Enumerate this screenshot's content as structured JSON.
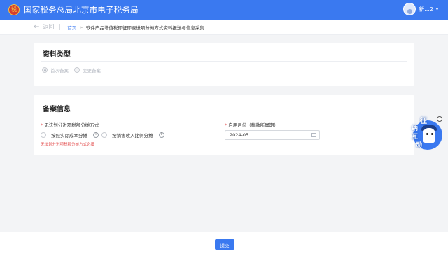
{
  "header": {
    "emblem": "税",
    "title": "国家税务总局北京市电子税务局",
    "user_name": "新...2",
    "caret": "▾"
  },
  "crumbbar": {
    "back_label": "返回",
    "back_arrow": "←",
    "home": "首页",
    "separator": ">",
    "current": "软件产品增值税即征即退进项分摊方式资料报送与信息采集"
  },
  "section_material": {
    "title": "资料类型",
    "options": [
      {
        "label": "首次备案",
        "checked": true
      },
      {
        "label": "变更备案",
        "checked": false
      }
    ]
  },
  "section_filing": {
    "title": "备案信息",
    "allocation_field": {
      "required_mark": "*",
      "label": "无法划分进项税额分摊方式",
      "options": [
        {
          "label": "按照实际成本分摊",
          "info": "i"
        },
        {
          "label": "按销售收入比例分摊",
          "info": "i"
        }
      ],
      "error": "无法划分进项税额分摊方式必填"
    },
    "start_month_field": {
      "required_mark": "*",
      "label": "启用月份（税款所属期）",
      "value": "2024-05"
    }
  },
  "footer": {
    "submit_label": "提交"
  },
  "float_widget": {
    "chars": [
      "征",
      "纳",
      "互",
      "动"
    ],
    "close": "-"
  },
  "colors": {
    "primary": "#3a79f0",
    "error": "#e34d4d",
    "background": "#f3f4f6"
  }
}
